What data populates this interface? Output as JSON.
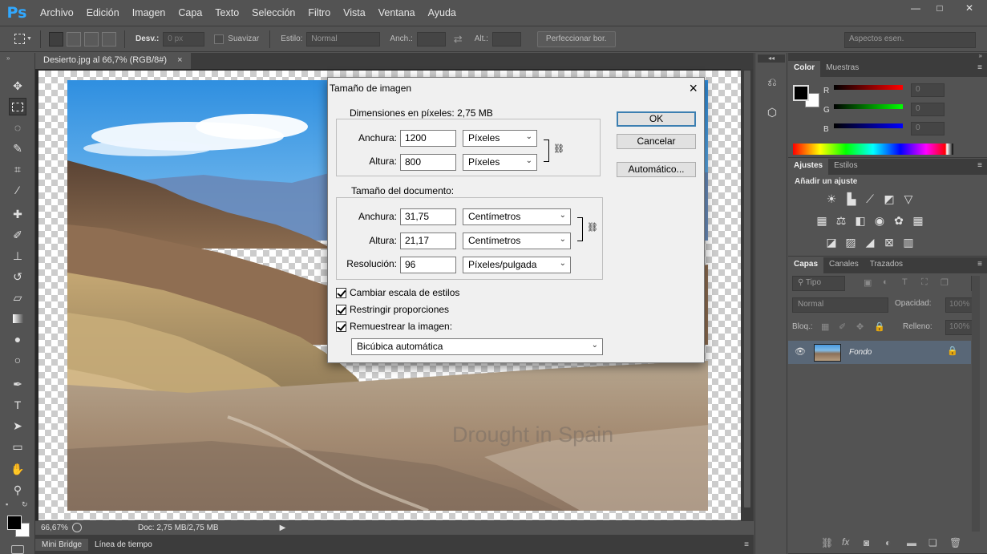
{
  "app": {
    "logo": "Ps",
    "menu": [
      "Archivo",
      "Edición",
      "Imagen",
      "Capa",
      "Texto",
      "Selección",
      "Filtro",
      "Vista",
      "Ventana",
      "Ayuda"
    ],
    "window_controls": {
      "minimize": "—",
      "maximize": "□",
      "close": "✕"
    }
  },
  "options_bar": {
    "desv_label": "Desv.:",
    "desv_value": "0 px",
    "suavizar_label": "Suavizar",
    "estilo_label": "Estilo:",
    "estilo_value": "Normal",
    "anch_label": "Anch.:",
    "alt_label": "Alt.:",
    "refine_button": "Perfeccionar bor.",
    "workspace": "Aspectos esen."
  },
  "document": {
    "tab_title": "Desierto.jpg al 66,7% (RGB/8#)",
    "tab_close": "×",
    "watermark": "Drought in Spain",
    "zoom": "66,67%",
    "doc_info": "Doc: 2,75 MB/2,75 MB"
  },
  "bottom_tabs": [
    "Mini Bridge",
    "Línea de tiempo"
  ],
  "color_panel": {
    "tabs": [
      "Color",
      "Muestras"
    ],
    "channels": [
      {
        "label": "R",
        "value": "0",
        "gradient": "#ff0000"
      },
      {
        "label": "G",
        "value": "0",
        "gradient": "#00ff00"
      },
      {
        "label": "B",
        "value": "0",
        "gradient": "#0000ff"
      }
    ]
  },
  "adjustments_panel": {
    "tabs": [
      "Ajustes",
      "Estilos"
    ],
    "heading": "Añadir un ajuste"
  },
  "layers_panel": {
    "tabs": [
      "Capas",
      "Canales",
      "Trazados"
    ],
    "filter_label": "Tipo",
    "blend_mode": "Normal",
    "opacity_label": "Opacidad:",
    "opacity_value": "100%",
    "lock_label": "Bloq.:",
    "fill_label": "Relleno:",
    "fill_value": "100%",
    "layer_name": "Fondo"
  },
  "dialog": {
    "title": "Tamaño de imagen",
    "pixel_dims_legend": "Dimensiones en píxeles: 2,75 MB",
    "width_label": "Anchura:",
    "width_value": "1200",
    "width_unit": "Píxeles",
    "height_label": "Altura:",
    "height_value": "800",
    "height_unit": "Píxeles",
    "doc_size_legend": "Tamaño del documento:",
    "doc_width_label": "Anchura:",
    "doc_width_value": "31,75",
    "doc_width_unit": "Centímetros",
    "doc_height_label": "Altura:",
    "doc_height_value": "21,17",
    "doc_height_unit": "Centímetros",
    "resolution_label": "Resolución:",
    "resolution_value": "96",
    "resolution_unit": "Píxeles/pulgada",
    "scale_styles": "Cambiar escala de estilos",
    "constrain": "Restringir proporciones",
    "resample": "Remuestrear la imagen:",
    "resample_method": "Bicúbica automática",
    "ok": "OK",
    "cancel": "Cancelar",
    "auto": "Automático..."
  }
}
